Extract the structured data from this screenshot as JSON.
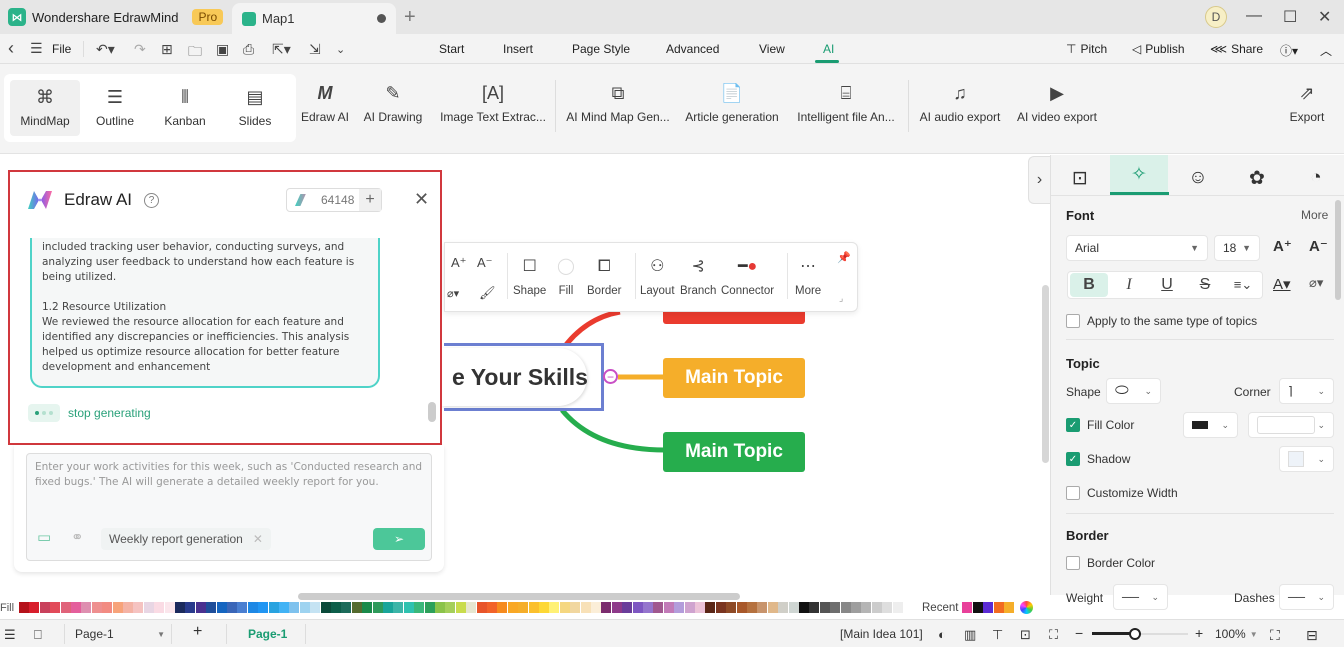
{
  "titlebar": {
    "app_name": "Wondershare EdrawMind",
    "pro_badge": "Pro",
    "doc_tab": "Map1",
    "new_tab_icon": "+",
    "avatar_letter": "D",
    "minimize": "—",
    "maximize": "☐",
    "close": "✕"
  },
  "menubar": {
    "back": "‹",
    "file": "File",
    "tabs": [
      "Start",
      "Insert",
      "Page Style",
      "Advanced",
      "View",
      "AI"
    ],
    "active_tab": "AI",
    "right": {
      "pitch": "Pitch",
      "publish": "Publish",
      "share": "Share"
    }
  },
  "ribbon": {
    "views": [
      {
        "label": "MindMap",
        "icon": "mindmap-icon"
      },
      {
        "label": "Outline",
        "icon": "outline-icon"
      },
      {
        "label": "Kanban",
        "icon": "kanban-icon"
      },
      {
        "label": "Slides",
        "icon": "slides-icon"
      }
    ],
    "ai_tools": [
      {
        "label": "Edraw AI"
      },
      {
        "label": "AI Drawing"
      },
      {
        "label": "Image Text Extrac..."
      },
      {
        "label": "AI Mind Map Gen..."
      },
      {
        "label": "Article generation"
      },
      {
        "label": "Intelligent file An..."
      },
      {
        "label": "AI audio export"
      },
      {
        "label": "AI video export"
      },
      {
        "label": "Export"
      }
    ]
  },
  "ai_panel": {
    "title": "Edraw AI",
    "credits": "64148",
    "message": {
      "p1": "included tracking user behavior, conducting surveys, and analyzing user feedback to understand how each feature is being utilized.",
      "heading": "1.2 Resource Utilization",
      "p2": "We reviewed the resource allocation for each feature and identified any discrepancies or inefficiencies. This analysis helped us optimize resource allocation for better feature development and enhancement"
    },
    "stop_label": "stop generating",
    "input_placeholder": "Enter your work activities for this week, such as 'Conducted research and fixed bugs.' The AI will generate a detailed weekly report for you.",
    "chip_label": "Weekly report generation"
  },
  "floating_toolbar": {
    "items": [
      "Shape",
      "Fill",
      "Border",
      "Layout",
      "Branch",
      "Connector",
      "More"
    ]
  },
  "mindmap": {
    "central_text": "e Your Skills",
    "topics": [
      {
        "text": "Main Topic",
        "color": "#f5ae2a"
      },
      {
        "text": "Main Topic",
        "color": "#26ad4d"
      }
    ],
    "top_topic_color": "#ea3b2e"
  },
  "right_panel": {
    "font_heading": "Font",
    "more": "More",
    "font_family": "Arial",
    "font_size": "18",
    "apply_same": "Apply to the same type of topics",
    "topic_heading": "Topic",
    "shape_label": "Shape",
    "corner_label": "Corner",
    "fill_color_label": "Fill Color",
    "fill_color_checked": true,
    "shadow_label": "Shadow",
    "shadow_checked": true,
    "customize_width_label": "Customize Width",
    "border_heading": "Border",
    "border_color_label": "Border Color",
    "weight_label": "Weight",
    "dashes_label": "Dashes"
  },
  "palette": {
    "fill_label": "Fill",
    "recent_label": "Recent",
    "recent_colors": [
      "#e8409a",
      "#111111",
      "#5b2bd4",
      "#f26b21",
      "#f5ae2a"
    ]
  },
  "status": {
    "page_select": "Page-1",
    "active_page": "Page-1",
    "selection": "[Main Idea 101]",
    "zoom": "100%",
    "zoom_fraction": 0.45
  },
  "accent": "#1a9c72"
}
